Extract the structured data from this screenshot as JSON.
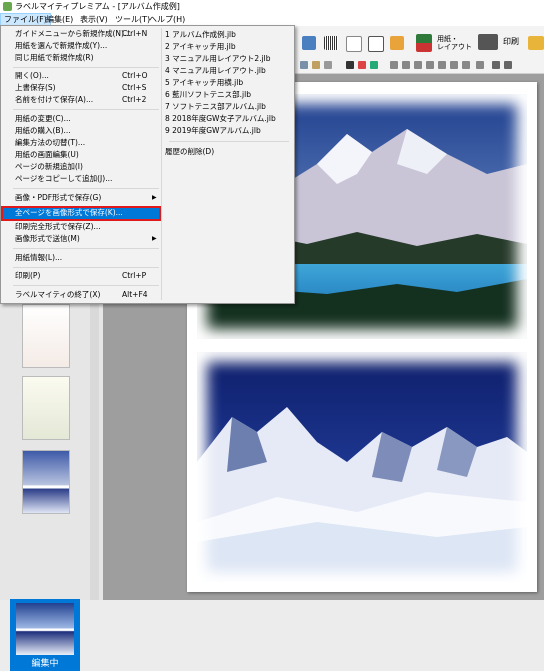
{
  "window": {
    "title": "ラベルマイティプレミアム - [アルバム作成例]"
  },
  "menubar": [
    {
      "label": "ファイル(F)"
    },
    {
      "label": "編集(E)"
    },
    {
      "label": "表示(V)"
    },
    {
      "label": "ツール(T)"
    },
    {
      "label": "ヘルプ(H)"
    }
  ],
  "toolbar": {
    "paper_layout_label": "用紙・\nレイアウト",
    "print_label": "印刷"
  },
  "file_menu": {
    "items": [
      {
        "label": "ガイドメニューから新規作成(N)...",
        "shortcut": "Ctrl+N"
      },
      {
        "label": "用紙を選んで新規作成(Y)...",
        "shortcut": ""
      },
      {
        "label": "同じ用紙で新規作成(R)",
        "shortcut": ""
      },
      {
        "label": "開く(O)...",
        "shortcut": "Ctrl+O"
      },
      {
        "label": "上書保存(S)",
        "shortcut": "Ctrl+S"
      },
      {
        "label": "名前を付けて保存(A)...",
        "shortcut": "Ctrl+2"
      },
      {
        "label": "用紙の変更(C)...",
        "shortcut": ""
      },
      {
        "label": "用紙の購入(B)...",
        "shortcut": ""
      },
      {
        "label": "編集方法の切替(T)...",
        "shortcut": ""
      },
      {
        "label": "用紙の画面編集(U)",
        "shortcut": ""
      },
      {
        "label": "ページの新規追加(I)",
        "shortcut": ""
      },
      {
        "label": "ページをコピーして追加(J)...",
        "shortcut": ""
      },
      {
        "label": "画像・PDF形式で保存(G)",
        "shortcut": "",
        "submenu": true
      },
      {
        "label": "全ページを画像形式で保存(K)...",
        "shortcut": "",
        "highlighted": true
      },
      {
        "label": "印刷完全形式で保存(Z)...",
        "shortcut": ""
      },
      {
        "label": "画像形式で送信(M)",
        "shortcut": "",
        "submenu": true
      },
      {
        "label": "用紙情報(L)...",
        "shortcut": ""
      },
      {
        "label": "印刷(P)",
        "shortcut": "Ctrl+P"
      },
      {
        "label": "ラベルマイティの終了(X)",
        "shortcut": "Alt+F4"
      }
    ],
    "recent_files": [
      "1 アルバム作成例.jlb",
      "2 アイキャッチ用.jlb",
      "3 マニュアル用レイアウト2.jlb",
      "4 マニュアル用レイアウト.jlb",
      "5 アイキャッチ用横.jlb",
      "6 藍川ソフトテニス部.jlb",
      "7 ソフトテニス部アルバム.jlb",
      "8 2018年度GW女子アルバム.jlb",
      "9 2019年度GWアルバム.jlb"
    ],
    "clear_history": "履歴の削除(D)"
  },
  "left_panel": {
    "editing_label": "編集中"
  },
  "colors": {
    "accent": "#0078d7",
    "highlight_border": "#e01a1a"
  }
}
